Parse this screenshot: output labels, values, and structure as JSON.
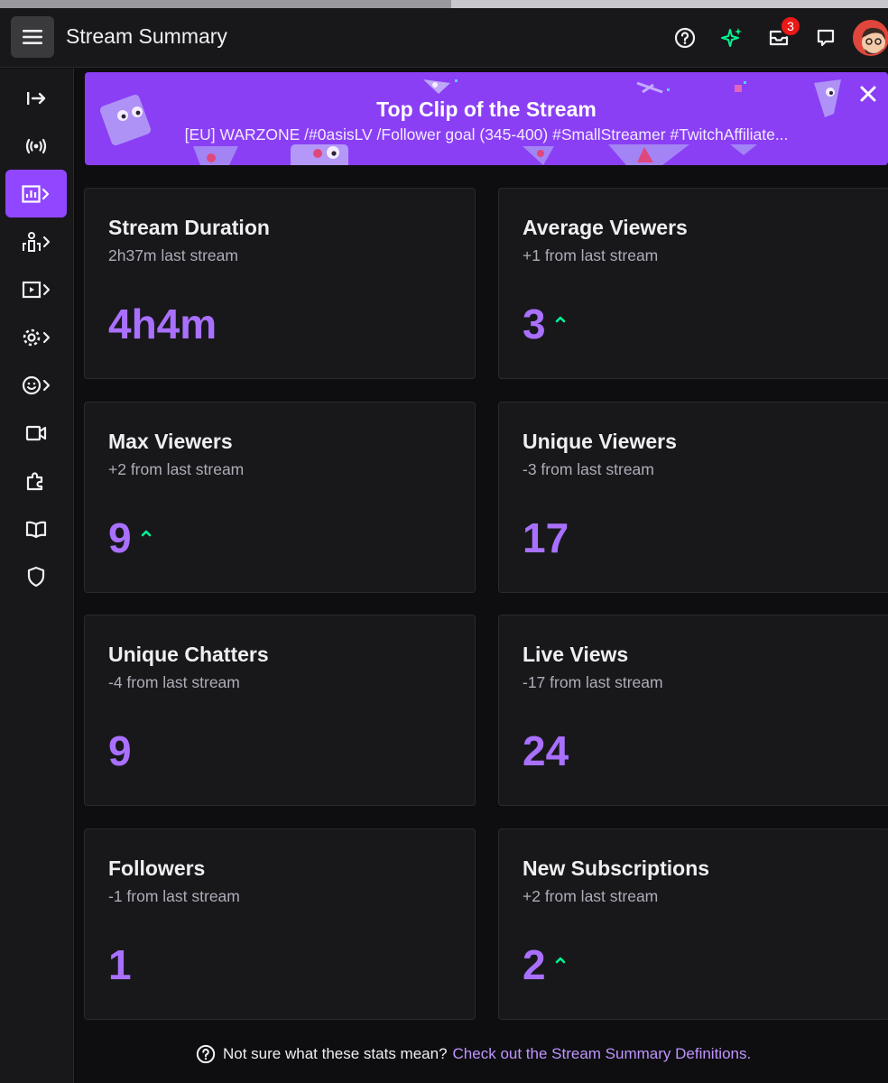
{
  "header": {
    "title": "Stream Summary",
    "inbox_count": "3"
  },
  "banner": {
    "title": "Top Clip of the Stream",
    "subtitle": "[EU] WARZONE /#0asisLV /Follower goal (345-400) #SmallStreamer #TwitchAffiliate..."
  },
  "stats": [
    {
      "title": "Stream Duration",
      "sub": "2h37m last stream",
      "value": "4h4m",
      "trend": "none"
    },
    {
      "title": "Average Viewers",
      "sub": "+1 from last stream",
      "value": "3",
      "trend": "up"
    },
    {
      "title": "Max Viewers",
      "sub": "+2 from last stream",
      "value": "9",
      "trend": "up"
    },
    {
      "title": "Unique Viewers",
      "sub": "-3 from last stream",
      "value": "17",
      "trend": "none"
    },
    {
      "title": "Unique Chatters",
      "sub": "-4 from last stream",
      "value": "9",
      "trend": "none"
    },
    {
      "title": "Live Views",
      "sub": "-17 from last stream",
      "value": "24",
      "trend": "none"
    },
    {
      "title": "Followers",
      "sub": "-1 from last stream",
      "value": "1",
      "trend": "none"
    },
    {
      "title": "New Subscriptions",
      "sub": "+2 from last stream",
      "value": "2",
      "trend": "up"
    }
  ],
  "footer": {
    "text": "Not sure what these stats mean?",
    "link": "Check out the Stream Summary Definitions."
  },
  "colors": {
    "accent": "#9147ff",
    "value": "#a970ff",
    "trend_up": "#00f593",
    "badge": "#e91916"
  },
  "sidebar_icons": [
    "collapse-icon",
    "broadcast-icon",
    "analytics-icon",
    "community-icon",
    "content-icon",
    "settings-icon",
    "emote-icon",
    "video-icon",
    "extensions-icon",
    "guide-icon",
    "safety-icon"
  ]
}
